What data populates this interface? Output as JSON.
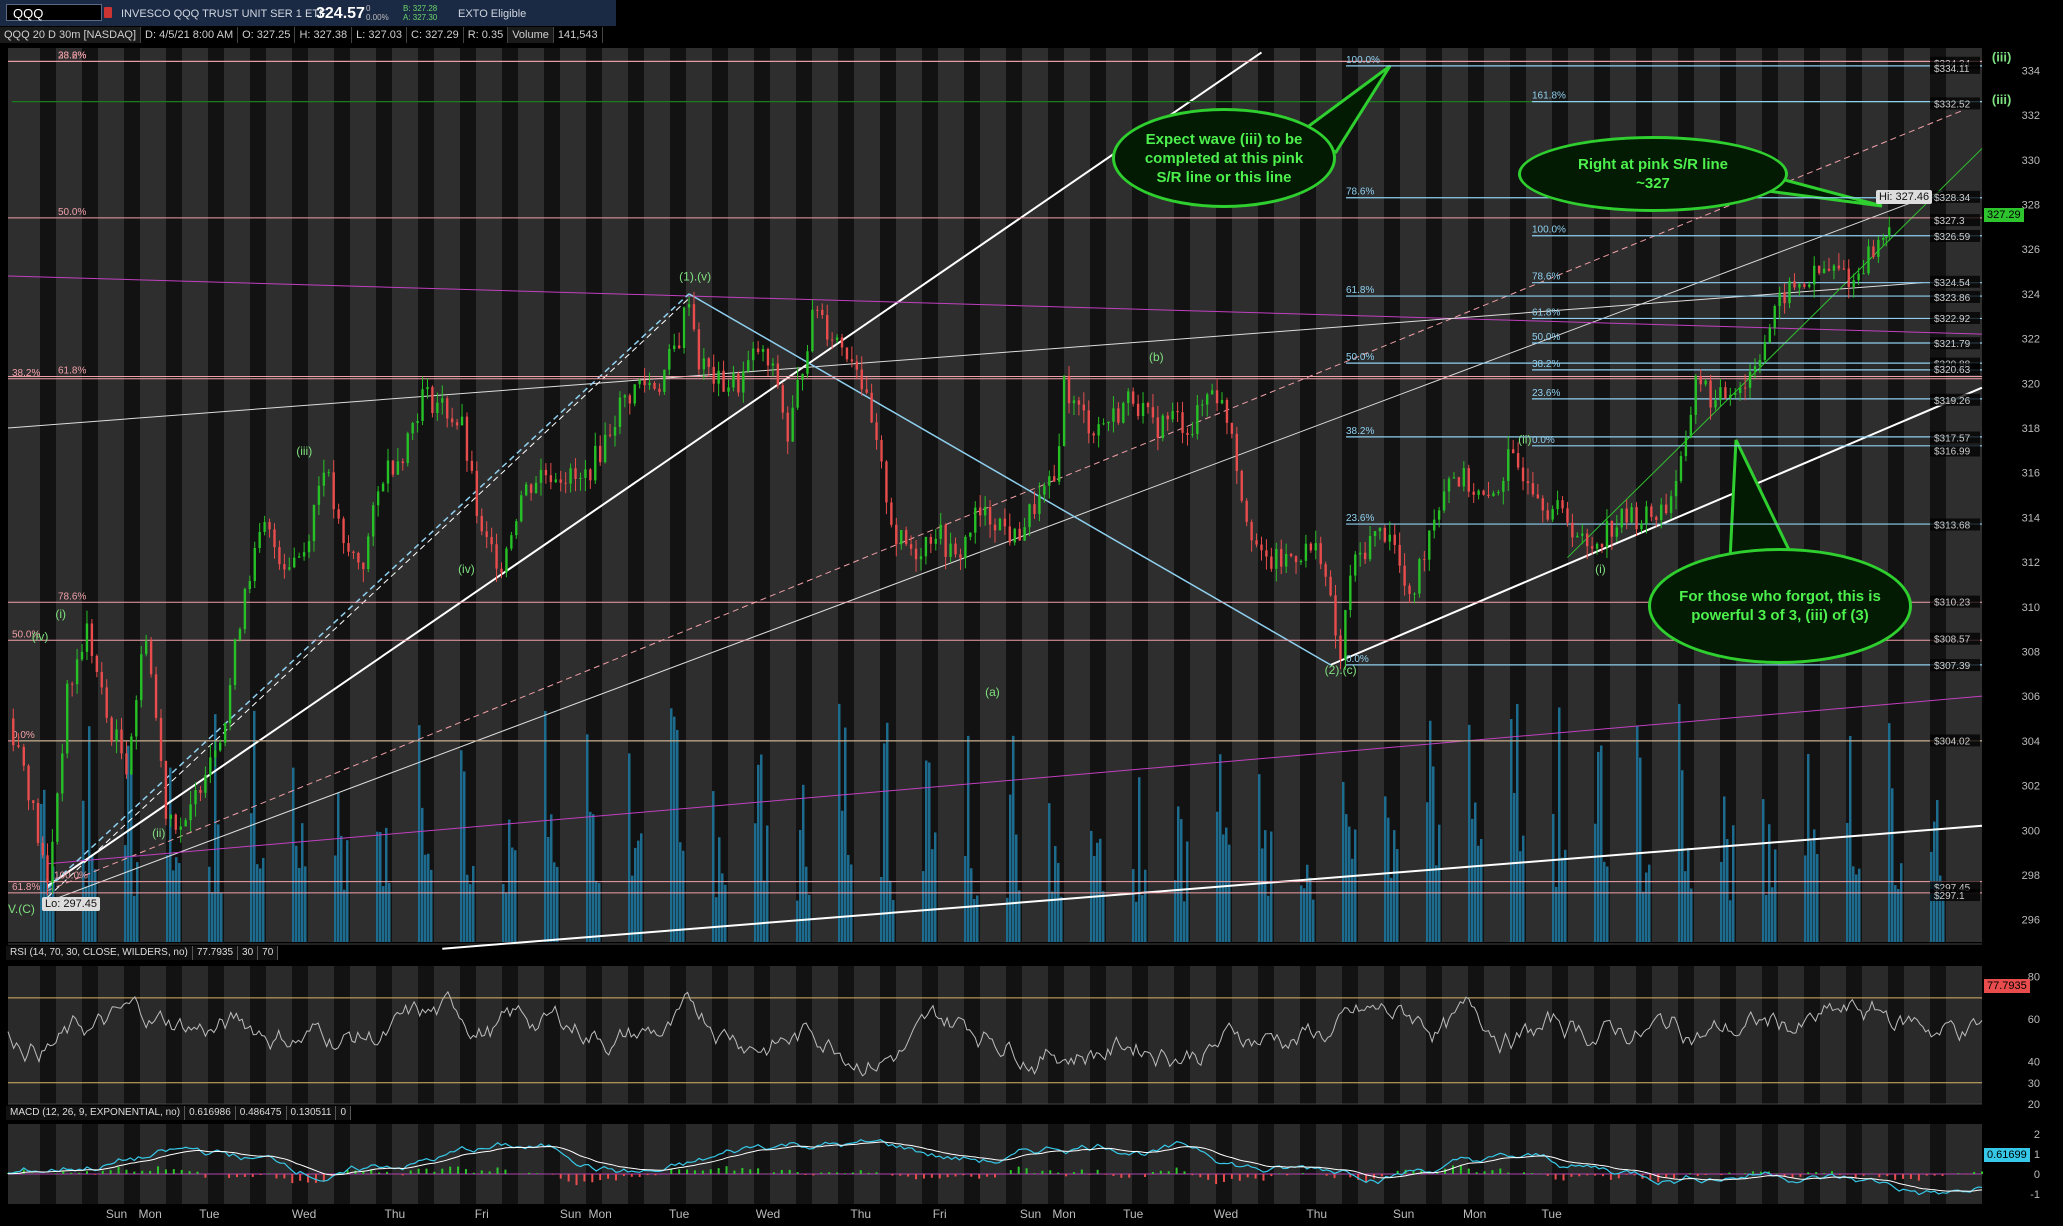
{
  "header": {
    "symbol": "QQQ",
    "description": "INVESCO QQQ TRUST UNIT SER 1 ETF",
    "last": "324.57",
    "change_top": "0",
    "change_bottom": "0.00%",
    "bid": "B: 327.28",
    "ask": "A: 327.30",
    "flag": "EXTO Eligible"
  },
  "infobar": {
    "title": "QQQ 20 D 30m [NASDAQ]",
    "date": "D: 4/5/21 8:00 AM",
    "open": "O: 327.25",
    "high": "H: 327.38",
    "low": "L: 327.03",
    "close": "C: 327.29",
    "range": "R: 0.35",
    "volume_label": "Volume",
    "volume": "141,543"
  },
  "colors": {
    "up": "#26c126",
    "down": "#e84c4c",
    "volume": "#1d6c8f",
    "fib_left": "#f0a0a8",
    "fib_right": "#8fd0f0",
    "wave": "#7fe07f",
    "magenta": "#c040c0",
    "bubble_border": "#2fcf2f",
    "rsi": "#bdbdbd",
    "macd": "#36c8e8"
  },
  "chart_data": [
    {
      "type": "candlestick",
      "title": "QQQ 20 D 30m [NASDAQ]",
      "ylim": [
        295,
        335
      ],
      "y_ticks": [
        "296",
        "298",
        "300",
        "302",
        "304",
        "306",
        "308",
        "310",
        "312",
        "314",
        "316",
        "318",
        "320",
        "322",
        "324",
        "326",
        "328",
        "330",
        "332",
        "334"
      ],
      "x_ticks": [
        "Sun",
        "Mon",
        "Tue",
        "Wed",
        "Thu",
        "Fri",
        "Sun",
        "Mon",
        "Tue",
        "Wed",
        "Thu",
        "Fri",
        "Sun",
        "Mon",
        "Tue",
        "Wed",
        "Thu",
        "Sun",
        "Mon",
        "Tue"
      ],
      "x_tick_pos": [
        0.055,
        0.072,
        0.102,
        0.15,
        0.196,
        0.24,
        0.285,
        0.3,
        0.34,
        0.385,
        0.432,
        0.472,
        0.518,
        0.535,
        0.57,
        0.617,
        0.663,
        0.707,
        0.743,
        0.782,
        0.838,
        0.88,
        0.92,
        0.95,
        0.98
      ],
      "price_points": [
        [
          0,
          305
        ],
        [
          0.008,
          303
        ],
        [
          0.02,
          297.5
        ],
        [
          0.03,
          306
        ],
        [
          0.04,
          309
        ],
        [
          0.05,
          305
        ],
        [
          0.06,
          303
        ],
        [
          0.07,
          309
        ],
        [
          0.08,
          301
        ],
        [
          0.09,
          300
        ],
        [
          0.1,
          303
        ],
        [
          0.11,
          305
        ],
        [
          0.12,
          311
        ],
        [
          0.13,
          313.5
        ],
        [
          0.14,
          312
        ],
        [
          0.15,
          312.5
        ],
        [
          0.16,
          316.5
        ],
        [
          0.17,
          312.5
        ],
        [
          0.18,
          312
        ],
        [
          0.19,
          316
        ],
        [
          0.2,
          317
        ],
        [
          0.21,
          319.5
        ],
        [
          0.22,
          319
        ],
        [
          0.23,
          318
        ],
        [
          0.24,
          313
        ],
        [
          0.25,
          312
        ],
        [
          0.26,
          315
        ],
        [
          0.27,
          316
        ],
        [
          0.28,
          316
        ],
        [
          0.29,
          315.5
        ],
        [
          0.3,
          317
        ],
        [
          0.31,
          319
        ],
        [
          0.32,
          320
        ],
        [
          0.33,
          320
        ],
        [
          0.34,
          322
        ],
        [
          0.345,
          324
        ],
        [
          0.35,
          321
        ],
        [
          0.36,
          320
        ],
        [
          0.37,
          320
        ],
        [
          0.38,
          321.5
        ],
        [
          0.39,
          320
        ],
        [
          0.395,
          317.5
        ],
        [
          0.405,
          322
        ],
        [
          0.41,
          323.5
        ],
        [
          0.415,
          322.5
        ],
        [
          0.42,
          322
        ],
        [
          0.43,
          321
        ],
        [
          0.44,
          317
        ],
        [
          0.45,
          313
        ],
        [
          0.46,
          312.5
        ],
        [
          0.47,
          313.5
        ],
        [
          0.48,
          312
        ],
        [
          0.49,
          314
        ],
        [
          0.5,
          314
        ],
        [
          0.51,
          313
        ],
        [
          0.52,
          314.5
        ],
        [
          0.53,
          315.5
        ],
        [
          0.535,
          320
        ],
        [
          0.54,
          319
        ],
        [
          0.55,
          318
        ],
        [
          0.56,
          318.5
        ],
        [
          0.57,
          319.5
        ],
        [
          0.58,
          318
        ],
        [
          0.59,
          318.5
        ],
        [
          0.6,
          318
        ],
        [
          0.61,
          320
        ],
        [
          0.62,
          318
        ],
        [
          0.625,
          315
        ],
        [
          0.635,
          312
        ],
        [
          0.645,
          312
        ],
        [
          0.655,
          312.5
        ],
        [
          0.665,
          312.5
        ],
        [
          0.675,
          307.5
        ],
        [
          0.68,
          311.5
        ],
        [
          0.69,
          313
        ],
        [
          0.7,
          313.5
        ],
        [
          0.71,
          310
        ],
        [
          0.72,
          313.5
        ],
        [
          0.73,
          316
        ],
        [
          0.74,
          315.5
        ],
        [
          0.75,
          314.5
        ],
        [
          0.76,
          316.5
        ],
        [
          0.77,
          316
        ],
        [
          0.78,
          314.5
        ],
        [
          0.79,
          314
        ],
        [
          0.8,
          312.5
        ],
        [
          0.81,
          313.5
        ],
        [
          0.82,
          314
        ],
        [
          0.83,
          314
        ],
        [
          0.84,
          314.5
        ],
        [
          0.85,
          317
        ],
        [
          0.855,
          320.5
        ],
        [
          0.865,
          319
        ],
        [
          0.875,
          320
        ],
        [
          0.88,
          320
        ],
        [
          0.89,
          322
        ],
        [
          0.9,
          324
        ],
        [
          0.91,
          324.5
        ],
        [
          0.92,
          325
        ],
        [
          0.93,
          325
        ],
        [
          0.935,
          324.5
        ],
        [
          0.94,
          325.5
        ],
        [
          0.95,
          326.5
        ],
        [
          0.953,
          327.3
        ]
      ],
      "annotations": [
        "(i)",
        "(iv)",
        "(ii)",
        "(iii)",
        "(iv)",
        "(1).(v)",
        "(a)",
        "(b)",
        "(2).(c)",
        "(i)",
        "(ii)",
        "(iii)",
        "(iii)",
        "V.(C)"
      ],
      "fib_left": [
        {
          "label": "23.6%",
          "value": 334.4
        },
        {
          "label": "38.2%",
          "value": 334.4
        },
        {
          "label": "50.0%",
          "value": 327.4
        },
        {
          "label": "38.2%",
          "value": 320.2
        },
        {
          "label": "61.8%",
          "value": 320.3
        },
        {
          "label": "78.6%",
          "value": 310.2
        },
        {
          "label": "50.0%",
          "value": 308.5
        },
        {
          "label": "0.0%",
          "value": 304.0
        },
        {
          "label": "100.0%",
          "value": 297.7
        },
        {
          "label": "61.8%",
          "value": 297.2
        }
      ],
      "fib_right": [
        {
          "label": "100.0%",
          "value": 334.2
        },
        {
          "label": "161.8%",
          "value": 332.6
        },
        {
          "label": "78.6%",
          "value": 328.3
        },
        {
          "label": "100.0%",
          "value": 326.6
        },
        {
          "label": "78.6%",
          "value": 324.5
        },
        {
          "label": "61.8%",
          "value": 323.9
        },
        {
          "label": "61.8%",
          "value": 322.9
        },
        {
          "label": "50.0%",
          "value": 321.8
        },
        {
          "label": "50.0%",
          "value": 320.9
        },
        {
          "label": "38.2%",
          "value": 320.6
        },
        {
          "label": "23.6%",
          "value": 319.3
        },
        {
          "label": "38.2%",
          "value": 317.6
        },
        {
          "label": "0.0%",
          "value": 317.2
        },
        {
          "label": "23.6%",
          "value": 313.7
        },
        {
          "label": "0.0%",
          "value": 307.4
        }
      ],
      "price_labels": [
        "$334.34",
        "$334.11",
        "$332.52",
        "$328.34",
        "$327.3",
        "$326.59",
        "$324.54",
        "$323.86",
        "$322.92",
        "$321.79",
        "$320.88",
        "$320.63",
        "$319.26",
        "$317.57",
        "$316.99",
        "$313.68",
        "$310.23",
        "$308.57",
        "$307.39",
        "$304.02",
        "$297.45",
        "$297.1"
      ],
      "price_label_vals": [
        334.34,
        334.11,
        332.52,
        328.34,
        327.3,
        326.59,
        324.54,
        323.86,
        322.92,
        321.79,
        320.88,
        320.63,
        319.26,
        317.57,
        316.99,
        313.68,
        310.23,
        308.57,
        307.39,
        304.02,
        297.45,
        297.1
      ],
      "hi_label": "Hi: 327.46",
      "lo_label": "Lo: 297.45",
      "last_tag": "327.29",
      "bubbles": [
        "Expect wave (iii) to be completed at this pink S/R line or this line",
        "Right at pink S/R line ~327",
        "For those who forgot, this is powerful 3 of 3, (iii) of (3)"
      ]
    },
    {
      "type": "line",
      "title": "RSI (14, 70, 30, CLOSE, WILDERS, no)",
      "value": "77.7935",
      "levels": [
        "30",
        "70"
      ],
      "ylim": [
        20,
        85
      ],
      "y_ticks": [
        "20",
        "30",
        "40",
        "60",
        "80"
      ],
      "last_tag": "77.7935"
    },
    {
      "type": "line",
      "title": "MACD (12, 26, 9, EXPONENTIAL, no)",
      "values": [
        "0.616986",
        "0.486475",
        "0.130511",
        "0"
      ],
      "ylim": [
        -1.5,
        2.5
      ],
      "y_ticks": [
        "2",
        "1",
        "0",
        "-1"
      ],
      "last_tag": "0.61699"
    }
  ]
}
